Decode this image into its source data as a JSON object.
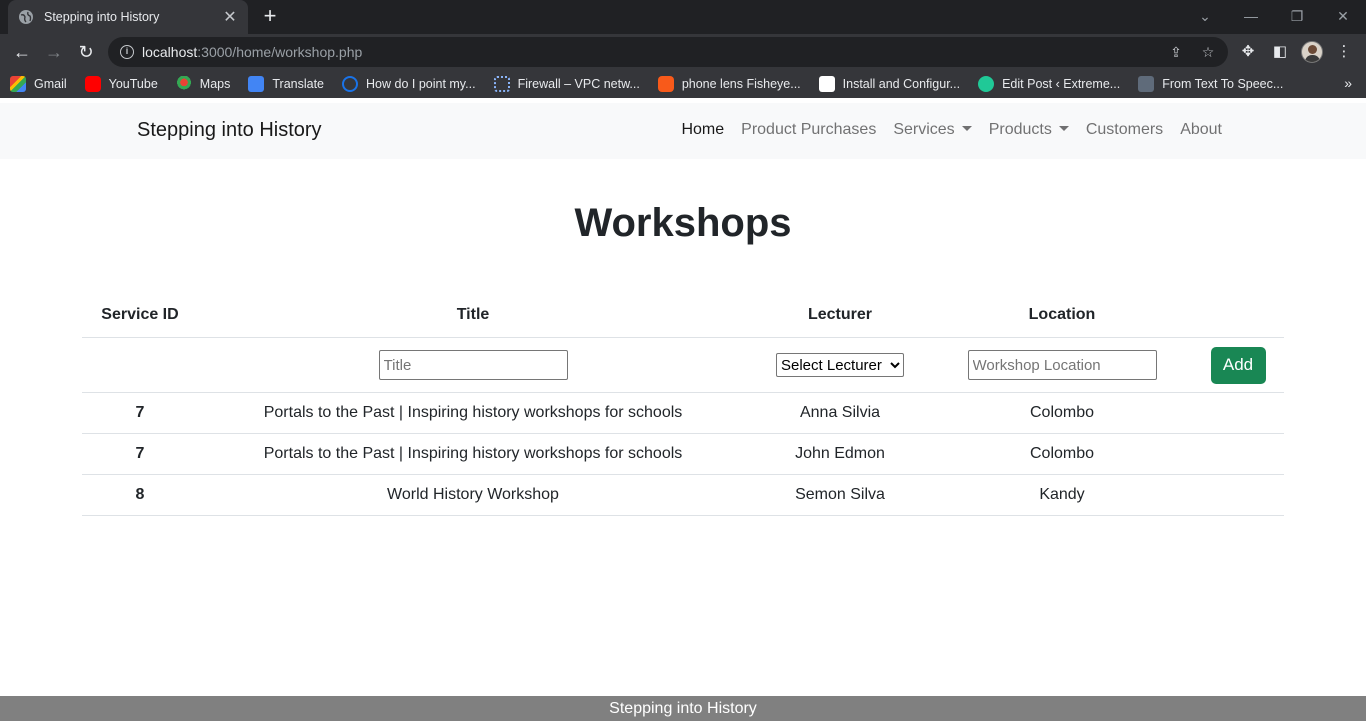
{
  "browser": {
    "tab_title": "Stepping into History",
    "url_host": "localhost",
    "url_rest": ":3000/home/workshop.php",
    "bookmarks": [
      {
        "label": "Gmail",
        "icon": "gmail-icon"
      },
      {
        "label": "YouTube",
        "icon": "youtube-icon"
      },
      {
        "label": "Maps",
        "icon": "maps-icon"
      },
      {
        "label": "Translate",
        "icon": "translate-icon"
      },
      {
        "label": "How do I point my...",
        "icon": "question-icon"
      },
      {
        "label": "Firewall – VPC netw...",
        "icon": "cloud-icon"
      },
      {
        "label": "phone lens Fisheye...",
        "icon": "shop-icon"
      },
      {
        "label": "Install and Configur...",
        "icon": "ut-icon"
      },
      {
        "label": "Edit Post ‹ Extreme...",
        "icon": "ew-icon"
      },
      {
        "label": "From Text To Speec...",
        "icon": "speech-icon"
      }
    ]
  },
  "navbar": {
    "brand": "Stepping into History",
    "links": [
      {
        "label": "Home",
        "active": true
      },
      {
        "label": "Product Purchases"
      },
      {
        "label": "Services",
        "dropdown": true
      },
      {
        "label": "Products",
        "dropdown": true
      },
      {
        "label": "Customers"
      },
      {
        "label": "About"
      }
    ]
  },
  "main": {
    "heading": "Workshops",
    "columns": [
      "Service ID",
      "Title",
      "Lecturer",
      "Location"
    ],
    "form": {
      "title_placeholder": "Title",
      "lecturer_selected": "Select Lecturer",
      "location_placeholder": "Workshop Location",
      "add_label": "Add"
    },
    "rows": [
      {
        "id": "7",
        "title": "Portals to the Past | Inspiring history workshops for schools",
        "lecturer": "Anna Silvia",
        "location": "Colombo"
      },
      {
        "id": "7",
        "title": "Portals to the Past | Inspiring history workshops for schools",
        "lecturer": "John Edmon",
        "location": "Colombo"
      },
      {
        "id": "8",
        "title": "World History Workshop",
        "lecturer": "Semon Silva",
        "location": "Kandy"
      }
    ]
  },
  "footer": {
    "text": "Stepping into History"
  },
  "colors": {
    "accent_button": "#198754",
    "navbar_bg": "#f8f9fa",
    "footer_bg": "#808080"
  }
}
